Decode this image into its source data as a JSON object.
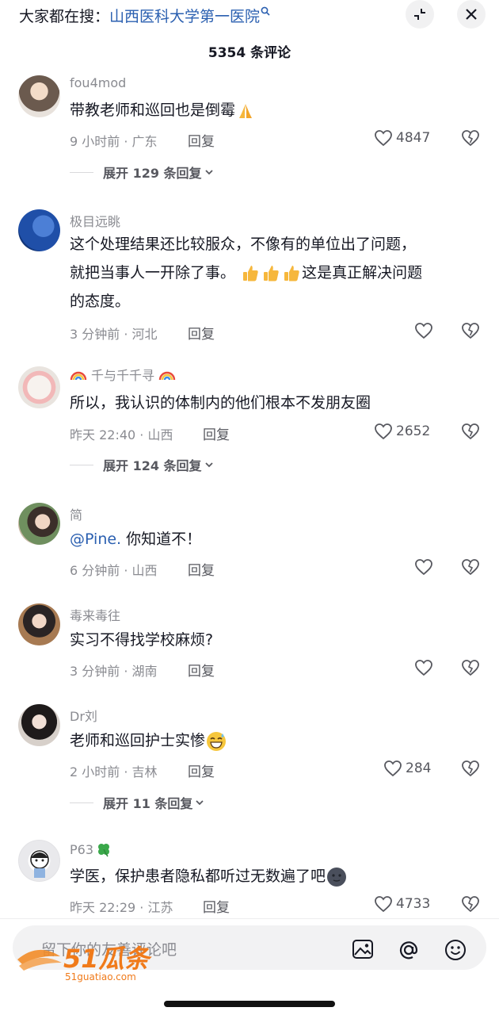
{
  "search_hint": {
    "prefix": "大家都在搜：",
    "keyword": "山西医科大学第一医院"
  },
  "header": {
    "title": "5354 条评论"
  },
  "comments": [
    {
      "username": "fou4mod",
      "text": "带教老师和巡回也是倒霉",
      "time": "9 小时前 · 广东",
      "reply": "回复",
      "likes": "4847",
      "expand": "展开 129 条回复"
    },
    {
      "username": "极目远眺",
      "text1": "这个处理结果还比较服众，不像有的单位出了问题，",
      "text2": "就把当事人一开除了事。",
      "text3": "这是真正解决问题",
      "text4": "的态度。",
      "time": "3 分钟前 · 河北",
      "reply": "回复"
    },
    {
      "username": "千与千千寻",
      "text": "所以，我认识的体制内的他们根本不发朋友圈",
      "time": "昨天 22:40 · 山西",
      "reply": "回复",
      "likes": "2652",
      "expand": "展开 124 条回复"
    },
    {
      "username": "简",
      "mention": "@Pine.",
      "text": " 你知道不！",
      "time": "6 分钟前 · 山西",
      "reply": "回复"
    },
    {
      "username": "毒来毒往",
      "text": "实习不得找学校麻烦?",
      "time": "3 分钟前 · 湖南",
      "reply": "回复"
    },
    {
      "username": "Dr刘",
      "text": "老师和巡回护士实惨",
      "time": "2 小时前 · 吉林",
      "reply": "回复",
      "likes": "284",
      "expand": "展开 11 条回复"
    },
    {
      "username": "P63",
      "text": "学医，保护患者隐私都听过无数遍了吧",
      "time": "昨天 22:29 · 江苏",
      "reply": "回复",
      "likes": "4733"
    }
  ],
  "input": {
    "placeholder": "留下你的友善评论吧"
  },
  "watermark": {
    "brand": "51瓜条",
    "domain": "51guatiao.com"
  },
  "colors": {
    "link": "#2a5fb0",
    "secondary": "#8a8b91",
    "text": "#161823"
  },
  "icons": [
    "search-icon",
    "collapse-icon",
    "close-icon",
    "heart-icon",
    "dislike-icon",
    "image-icon",
    "at-icon",
    "emoji-icon"
  ]
}
